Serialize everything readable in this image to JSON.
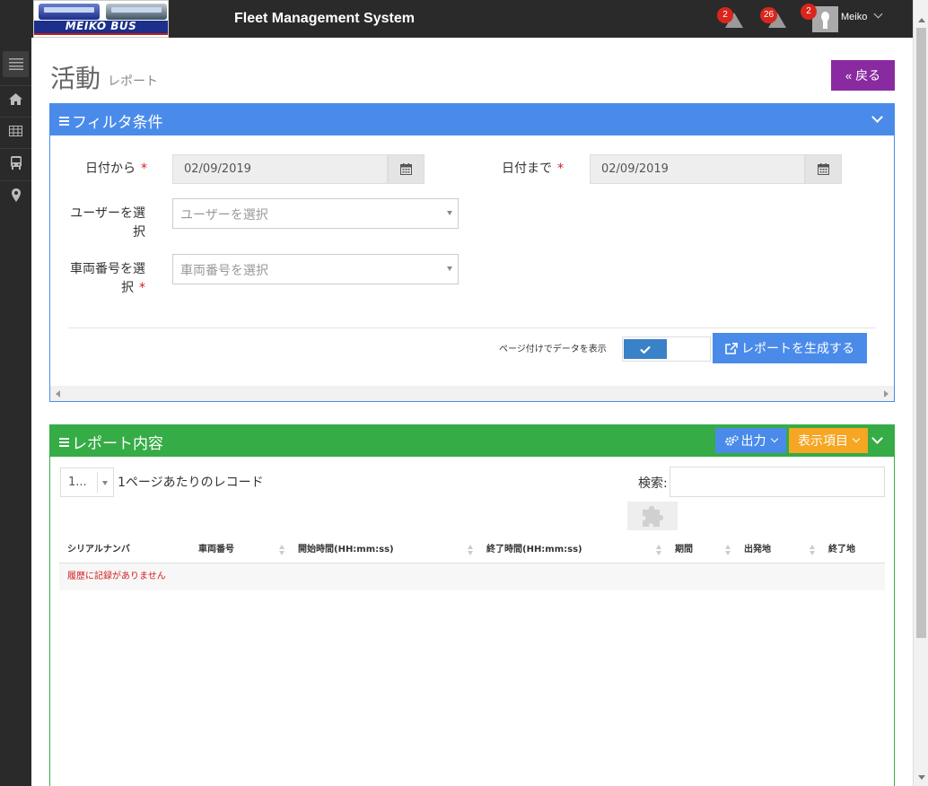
{
  "header": {
    "logo_text": "MEIKO BUS",
    "app_title": "Fleet Management System",
    "alerts": [
      {
        "count": "2",
        "icon": "warning-icon"
      },
      {
        "count": "26",
        "icon": "warning-icon"
      }
    ],
    "user": {
      "badge": "2",
      "name": "Meiko"
    }
  },
  "sidebar": {
    "items": [
      {
        "icon": "menu-icon"
      },
      {
        "icon": "home-icon"
      },
      {
        "icon": "table-icon"
      },
      {
        "icon": "bus-icon"
      },
      {
        "icon": "map-marker-icon"
      }
    ]
  },
  "page": {
    "title": "活動",
    "subtitle": "レポート",
    "back_label": "戻る"
  },
  "filter": {
    "title": "フィルタ条件",
    "date_from_label": "日付から",
    "date_from_value": "02/09/2019",
    "date_to_label": "日付まで",
    "date_to_value": "02/09/2019",
    "user_label": "ユーザーを選択",
    "user_placeholder": "ユーザーを選択",
    "vehicle_label": "車両番号を選択",
    "vehicle_placeholder": "車両番号を選択",
    "required_mark": "*",
    "paging_label": "ページ付けでデータを表示",
    "generate_label": "レポートを生成する"
  },
  "report": {
    "title": "レポート内容",
    "export_label": "出力",
    "columns_label": "表示項目",
    "page_length": "1...",
    "page_length_label": "1ページあたりのレコード",
    "search_label": "検索:",
    "columns": [
      "シリアルナンバ",
      "車両番号",
      "開始時間(HH:mm:ss)",
      "終了時間(HH:mm:ss)",
      "期間",
      "出発地",
      "終了地"
    ],
    "empty_message": "履歴に記録がありません"
  },
  "colors": {
    "primary": "#4a8bea",
    "success": "#35ac45",
    "purple": "#8a2aa0",
    "warning": "#f5a623",
    "danger": "#d9261c",
    "dark": "#2a2a2a"
  }
}
